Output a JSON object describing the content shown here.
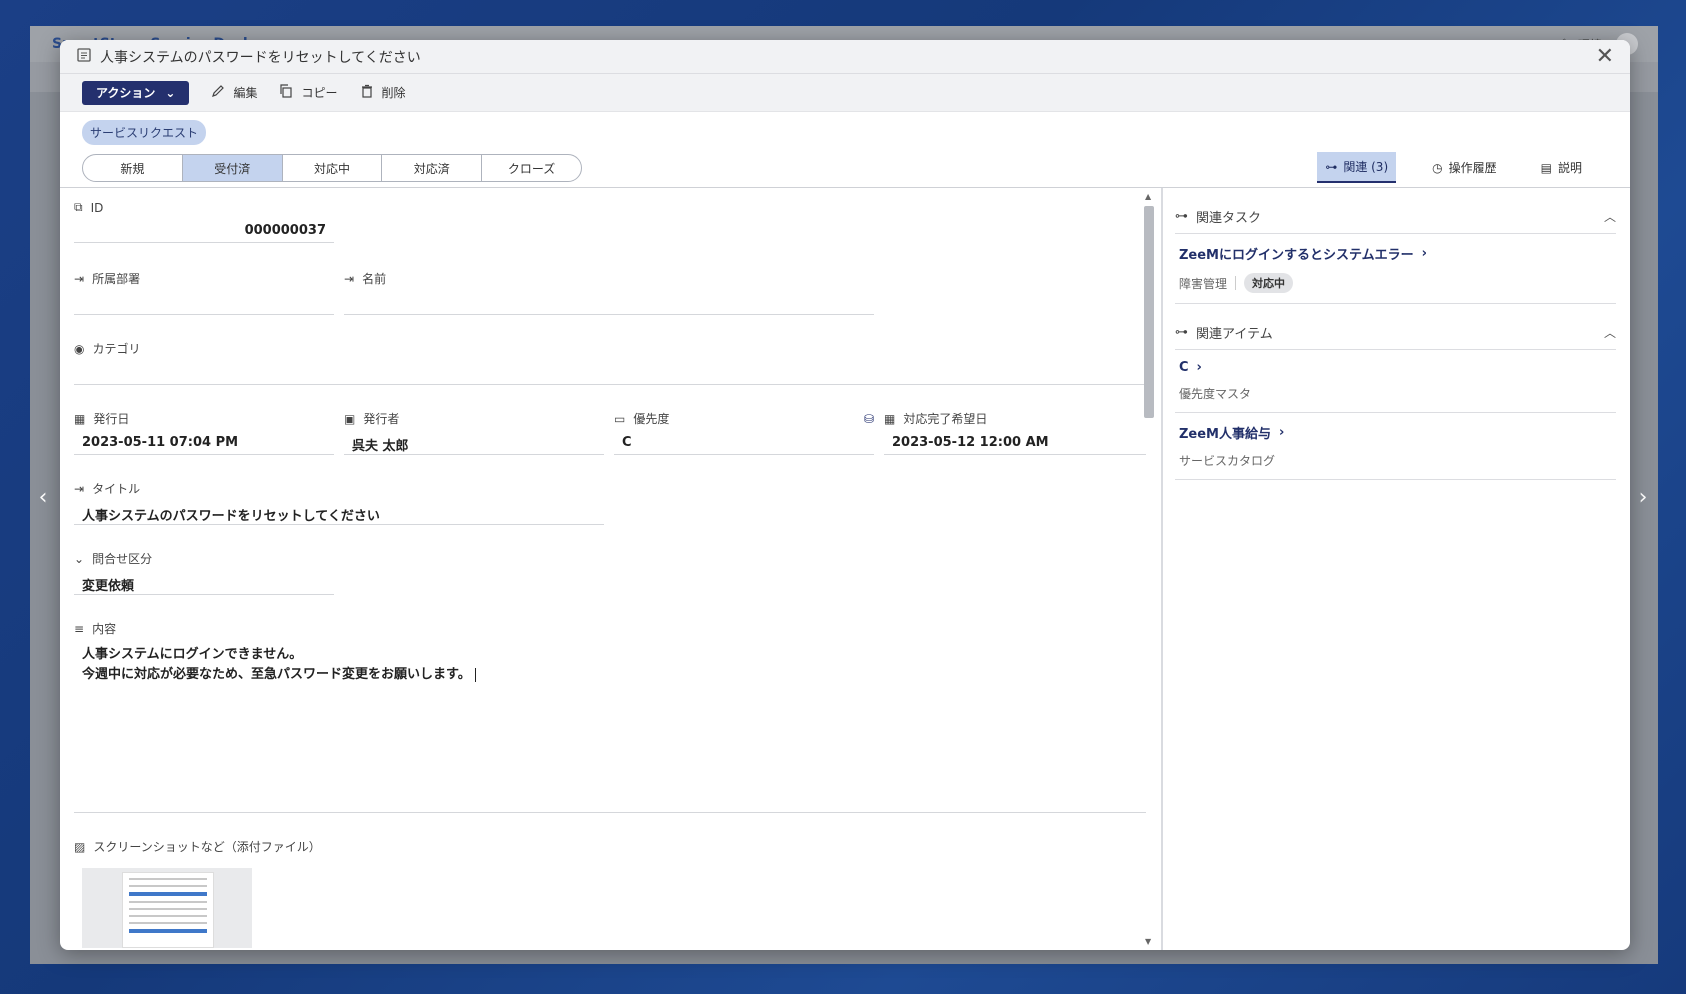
{
  "background": {
    "app_title": "SmartStage Service Desk",
    "env_label": "デモ環境"
  },
  "modal": {
    "title": "人事システムのパスワードをリセットしてください",
    "toolbar": {
      "action_label": "アクション",
      "edit_label": "編集",
      "copy_label": "コピー",
      "delete_label": "削除"
    },
    "type_chip": "サービスリクエスト",
    "steps": [
      "新規",
      "受付済",
      "対応中",
      "対応済",
      "クローズ"
    ],
    "active_step": "受付済",
    "right_tabs": {
      "related": "関連 (3)",
      "history": "操作履歴",
      "description": "説明"
    }
  },
  "form": {
    "id": {
      "label": "ID",
      "value": "000000037"
    },
    "department": {
      "label": "所属部署",
      "value": ""
    },
    "name": {
      "label": "名前",
      "value": ""
    },
    "category": {
      "label": "カテゴリ",
      "value": ""
    },
    "issue_date": {
      "label": "発行日",
      "value": "2023-05-11 07:04 PM"
    },
    "issuer": {
      "label": "発行者",
      "value": "呉夫 太郎"
    },
    "priority": {
      "label": "優先度",
      "value": "C"
    },
    "due_date": {
      "label": "対応完了希望日",
      "value": "2023-05-12 12:00 AM"
    },
    "title": {
      "label": "タイトル",
      "value": "人事システムのパスワードをリセットしてください"
    },
    "inquiry_type": {
      "label": "問合せ区分",
      "value": "変更依頼"
    },
    "content": {
      "label": "内容",
      "line1": "人事システムにログインできません。",
      "line2": "今週中に対応が必要なため、至急パスワード変更をお願いします。"
    },
    "attachments": {
      "label": "スクリーンショットなど（添付ファイル）"
    }
  },
  "side": {
    "related_tasks": {
      "heading": "関連タスク",
      "items": [
        {
          "link": "ZeeMにログインするとシステムエラー",
          "category": "障害管理",
          "status": "対応中"
        }
      ]
    },
    "related_items": {
      "heading": "関連アイテム",
      "items": [
        {
          "link": "C",
          "category": "優先度マスタ"
        },
        {
          "link": "ZeeM人事給与",
          "category": "サービスカタログ"
        }
      ]
    }
  },
  "colors": {
    "primary": "#24306e",
    "accent_light": "#c4d3ee",
    "background": "#1b3f86"
  }
}
